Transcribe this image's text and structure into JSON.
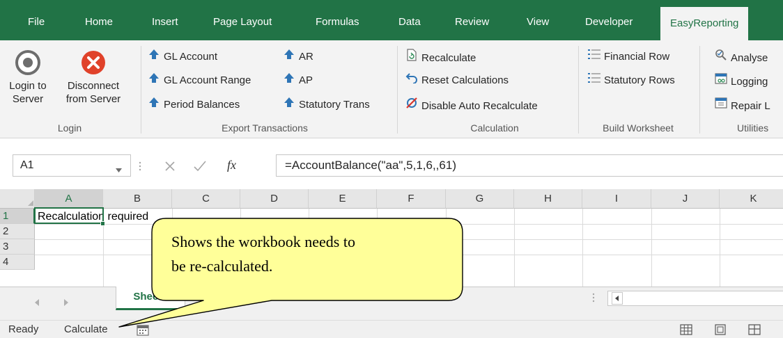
{
  "tabs": [
    "File",
    "Home",
    "Insert",
    "Page Layout",
    "Formulas",
    "Data",
    "Review",
    "View",
    "Developer"
  ],
  "active_tab": "EasyReporting",
  "ribbon": {
    "login": {
      "login_line1": "Login to",
      "login_line2": "Server",
      "disconnect_line1": "Disconnect",
      "disconnect_line2": "from Server",
      "label": "Login"
    },
    "export": {
      "gl_account": "GL Account",
      "gl_account_range": "GL Account Range",
      "period_balances": "Period Balances",
      "ar": "AR",
      "ap": "AP",
      "statutory_trans": "Statutory Trans",
      "label": "Export Transactions"
    },
    "calculation": {
      "recalculate": "Recalculate",
      "reset": "Reset Calculations",
      "disable_auto": "Disable Auto Recalculate",
      "label": "Calculation"
    },
    "build": {
      "financial_row": "Financial Row",
      "statutory_rows": "Statutory Rows",
      "label": "Build Worksheet"
    },
    "utilities": {
      "analyse": "Analyse",
      "logging": "Logging",
      "repair": "Repair L",
      "label": "Utilities"
    }
  },
  "formula_bar": {
    "cell_ref": "A1",
    "fx": "fx",
    "formula": "=AccountBalance(\"aa\",5,1,6,,61)"
  },
  "grid": {
    "columns": [
      "A",
      "B",
      "C",
      "D",
      "E",
      "F",
      "G",
      "H",
      "I",
      "J",
      "K"
    ],
    "rows": [
      "1",
      "2",
      "3",
      "4"
    ],
    "a1_value": "Recalculation required"
  },
  "sheet_tab": "Sheet1",
  "status": {
    "ready": "Ready",
    "calculate": "Calculate"
  },
  "callout": {
    "line1": "Shows the workbook needs to",
    "line2": "be re-calculated."
  },
  "colors": {
    "excel_green": "#217346",
    "callout_fill": "#ffff99",
    "disconnect_red": "#e0422a",
    "export_arrow_blue": "#2e75b6"
  },
  "icons": {
    "login": "login-target-icon",
    "disconnect": "disconnect-x-icon",
    "export": "up-arrow-icon",
    "recalculate": "recalculate-icon",
    "reset": "undo-icon",
    "disable": "disable-recalc-icon",
    "build": "list-icon",
    "analyse": "analyse-icon",
    "logging": "logging-icon",
    "repair": "repair-icon"
  }
}
